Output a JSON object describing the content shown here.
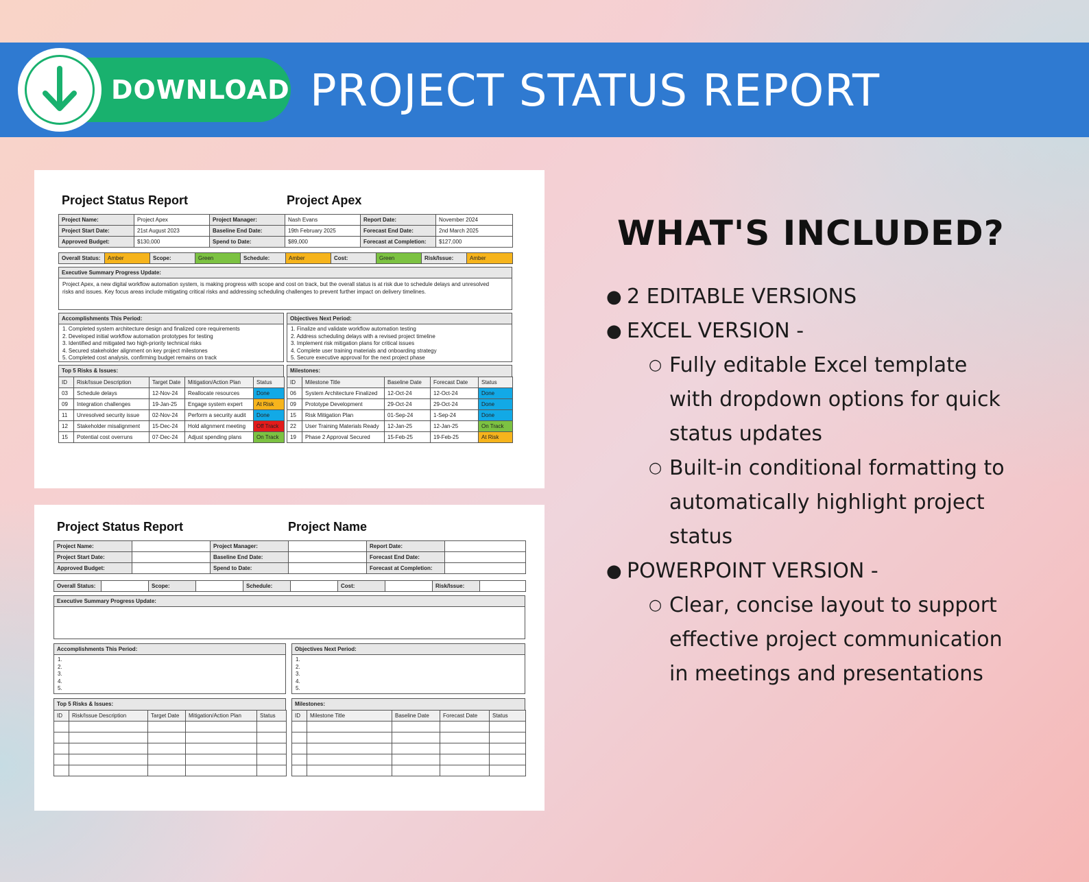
{
  "banner": {
    "download_label": "DOWNLOAD",
    "title": "PROJECT STATUS REPORT"
  },
  "colors": {
    "banner_blue": "#2f7ad1",
    "download_green": "#19b16e",
    "amber": "#f6b41c",
    "green": "#7cc242",
    "done_blue": "#12a9e6",
    "off_track_red": "#e31b1b"
  },
  "report1": {
    "title": "Project Status Report",
    "project": "Project Apex",
    "info_rows": [
      [
        "Project Name:",
        "Project Apex",
        "Project Manager:",
        "Nash Evans",
        "Report Date:",
        "November 2024"
      ],
      [
        "Project Start Date:",
        "21st August 2023",
        "Baseline End Date:",
        "19th February 2025",
        "Forecast End Date:",
        "2nd March 2025"
      ],
      [
        "Approved Budget:",
        "$130,000",
        "Spend to Date:",
        "$89,000",
        "Forecast at Completion:",
        "$127,000"
      ]
    ],
    "status_row": [
      "Overall Status:",
      "Amber",
      "Scope:",
      "Green",
      "Schedule:",
      "Amber",
      "Cost:",
      "Green",
      "Risk/Issue:",
      "Amber"
    ],
    "summary_label": "Executive Summary Progress Update:",
    "summary_text": [
      "Project Apex, a new digital workflow automation system, is making progress with scope and cost on track, but the overall status is at risk due to schedule delays and unresolved",
      "risks and issues. Key focus areas include mitigating critical risks and addressing scheduling challenges to prevent further impact on delivery timelines."
    ],
    "accomplishments_label": "Accomplishments This Period:",
    "accomplishments": [
      "1. Completed system architecture design and finalized core requirements",
      "2. Developed initial workflow automation prototypes for testing",
      "3. Identified and mitigated two high-priority technical risks",
      "4. Secured stakeholder alignment on key project milestones",
      "5. Completed cost analysis, confirming budget remains on track"
    ],
    "objectives_label": "Objectives Next Period:",
    "objectives": [
      "1. Finalize and validate workflow automation testing",
      "2. Address scheduling delays with a revised project timeline",
      "3. Implement risk mitigation plans for critical issues",
      "4. Complete user training materials and onboarding strategy",
      "5. Secure executive approval for the next project phase"
    ],
    "risks_label": "Top 5 Risks & Issues:",
    "risks_headers": [
      "ID",
      "Risk/Issue Description",
      "Target Date",
      "Mitigation/Action Plan",
      "Status"
    ],
    "risks": [
      [
        "03",
        "Schedule delays",
        "12-Nov-24",
        "Reallocate resources",
        "Done"
      ],
      [
        "09",
        "Integration challenges",
        "19-Jan-25",
        "Engage system expert",
        "At Risk"
      ],
      [
        "11",
        "Unresolved security issue",
        "02-Nov-24",
        "Perform a security audit",
        "Done"
      ],
      [
        "12",
        "Stakeholder misalignment",
        "15-Dec-24",
        "Hold alignment meeting",
        "Off Track"
      ],
      [
        "15",
        "Potential cost overruns",
        "07-Dec-24",
        "Adjust spending plans",
        "On Track"
      ]
    ],
    "milestones_label": "Milestones:",
    "milestones_headers": [
      "ID",
      "Milestone Title",
      "Baseline Date",
      "Forecast Date",
      "Status"
    ],
    "milestones": [
      [
        "06",
        "System Architecture Finalized",
        "12-Oct-24",
        "12-Oct-24",
        "Done"
      ],
      [
        "09",
        "Prototype Development",
        "29-Oct-24",
        "29-Oct-24",
        "Done"
      ],
      [
        "15",
        "Risk Mitigation Plan",
        "01-Sep-24",
        "1-Sep-24",
        "Done"
      ],
      [
        "22",
        "User Training Materials Ready",
        "12-Jan-25",
        "12-Jan-25",
        "On Track"
      ],
      [
        "19",
        "Phase 2 Approval Secured",
        "15-Feb-25",
        "19-Feb-25",
        "At Risk"
      ]
    ]
  },
  "report2": {
    "title": "Project Status Report",
    "project": "Project Name",
    "info_rows": [
      [
        "Project Name:",
        "",
        "Project Manager:",
        "",
        "Report Date:",
        ""
      ],
      [
        "Project Start Date:",
        "",
        "Baseline End Date:",
        "",
        "Forecast End Date:",
        ""
      ],
      [
        "Approved Budget:",
        "",
        "Spend to Date:",
        "",
        "Forecast at Completion:",
        ""
      ]
    ],
    "status_row": [
      "Overall Status:",
      "",
      "Scope:",
      "",
      "Schedule:",
      "",
      "Cost:",
      "",
      "Risk/Issue:",
      ""
    ],
    "summary_label": "Executive Summary Progress Update:",
    "accomplishments_label": "Accomplishments This Period:",
    "objectives_label": "Objectives Next Period:",
    "numbered": [
      "1.",
      "2.",
      "3.",
      "4.",
      "5."
    ],
    "risks_label": "Top 5 Risks & Issues:",
    "risks_headers": [
      "ID",
      "Risk/Issue Description",
      "Target Date",
      "Mitigation/Action Plan",
      "Status"
    ],
    "milestones_label": "Milestones:",
    "milestones_headers": [
      "ID",
      "Milestone Title",
      "Baseline Date",
      "Forecast Date",
      "Status"
    ]
  },
  "included": {
    "heading": "WHAT'S INCLUDED?",
    "item1": "2 EDITABLE VERSIONS",
    "item2": "EXCEL VERSION -",
    "item2_sub1": [
      " Fully editable Excel template",
      "with dropdown options for quick",
      "status updates"
    ],
    "item2_sub2": [
      "Built-in conditional formatting to",
      "automatically highlight project",
      "status"
    ],
    "item3": "POWERPOINT VERSION -",
    "item3_sub1": [
      "Clear, concise layout to support",
      "effective project communication",
      "in meetings and presentations"
    ],
    "bullet_icon": "bullet-dot",
    "sub_bullet_icon": "hollow-circle"
  }
}
